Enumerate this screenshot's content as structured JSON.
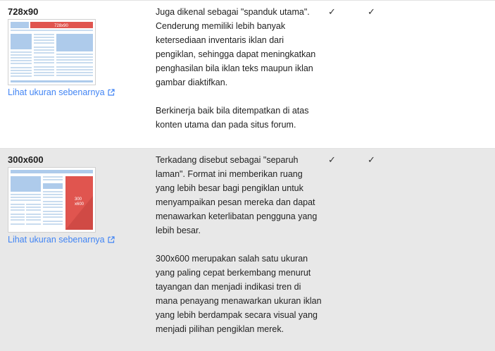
{
  "rows": [
    {
      "size": "728x90",
      "thumb_label": "728x90",
      "link": "Lihat ukuran sebenarnya",
      "paragraphs": [
        "Juga dikenal sebagai \"spanduk utama\". Cenderung memiliki lebih banyak ketersediaan inventaris iklan dari pengiklan, sehingga dapat meningkatkan penghasilan bila iklan teks maupun iklan gambar diaktifkan.",
        "Berkinerja baik bila ditempatkan di atas konten utama dan pada situs forum."
      ],
      "check1": "✓",
      "check2": "✓"
    },
    {
      "size": "300x600",
      "thumb_label_line1": "300",
      "thumb_label_line2": "x600",
      "link": "Lihat ukuran sebenarnya",
      "paragraphs": [
        "Terkadang disebut sebagai \"separuh laman\". Format ini memberikan ruang yang lebih besar bagi pengiklan untuk menyampaikan pesan mereka dan dapat menawarkan keterlibatan pengguna yang lebih besar.",
        "300x600 merupakan salah satu ukuran yang paling cepat berkembang menurut tayangan dan menjadi indikasi tren di mana penayang menawarkan ukuran iklan yang lebih berdampak secara visual yang menjadi pilihan pengiklan merek."
      ],
      "check1": "✓",
      "check2": "✓"
    }
  ],
  "colors": {
    "ad_red": "#e0554f",
    "placeholder_blue": "#aecbeb",
    "link_blue": "#4285f4"
  },
  "icons": {
    "external_link": "open-in-new-icon"
  }
}
